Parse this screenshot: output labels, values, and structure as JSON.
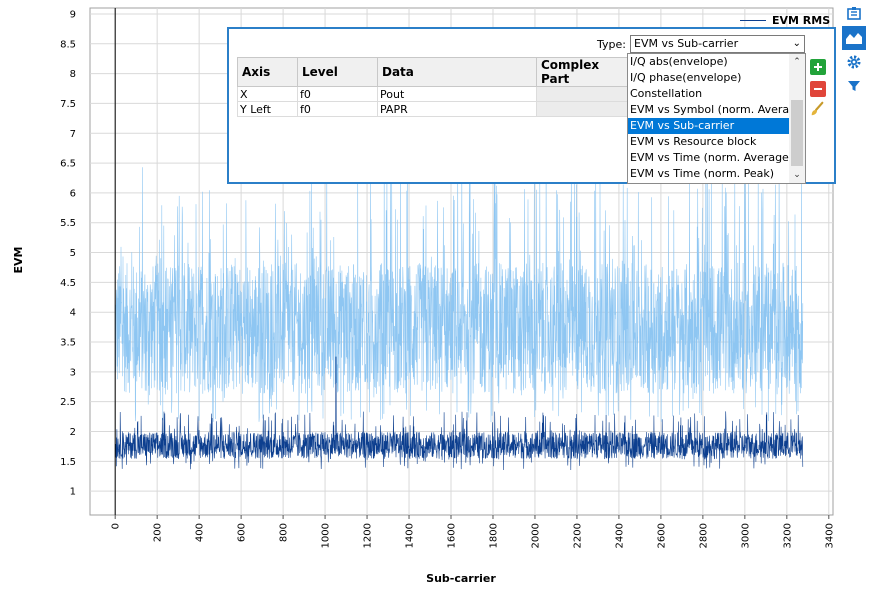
{
  "chart_data": {
    "type": "line",
    "title": "",
    "xlabel": "Sub-carrier",
    "ylabel": "EVM",
    "xlim": [
      -120,
      3420
    ],
    "ylim": [
      0.6,
      9.1
    ],
    "x_ticks": [
      0,
      200,
      400,
      600,
      800,
      1000,
      1200,
      1400,
      1600,
      1800,
      2000,
      2200,
      2400,
      2600,
      2800,
      3000,
      3200,
      3400
    ],
    "y_ticks": [
      1,
      1.5,
      2,
      2.5,
      3,
      3.5,
      4,
      4.5,
      5,
      5.5,
      6,
      6.5,
      7,
      7.5,
      8,
      8.5,
      9
    ],
    "grid": true,
    "legend_position": "top-right",
    "x_range": [
      0,
      3276
    ],
    "series": [
      {
        "name": "EVM RMS",
        "color": "#0d3f8f",
        "baseline": 1.7,
        "spread": 0.45,
        "min": 1.05,
        "max": 2.5,
        "spike_x": 1052,
        "spike_y": 3.25
      },
      {
        "name": "",
        "color": "#8ec6f2",
        "baseline": 3.4,
        "spread": 2.2,
        "min": 2.15,
        "max": 7.6
      }
    ]
  },
  "legend": {
    "label": "EVM RMS"
  },
  "config": {
    "type_label": "Type:",
    "type_value": "EVM vs Sub-carrier",
    "table_headers": [
      "Axis",
      "Level",
      "Data",
      "Complex Part"
    ],
    "rows": [
      {
        "axis": "X",
        "level": "f0",
        "data": "Pout"
      },
      {
        "axis": "Y Left",
        "level": "f0",
        "data": "PAPR"
      }
    ],
    "dropdown_items": [
      "I/Q abs(envelope)",
      "I/Q phase(envelope)",
      "Constellation",
      "EVM vs Symbol (norm. Average)",
      "EVM vs Sub-carrier",
      "EVM vs Resource block",
      "EVM vs Time (norm. Average)",
      "EVM vs Time (norm. Peak)"
    ],
    "selected_item": "EVM vs Sub-carrier"
  },
  "toolbar": {
    "icons": [
      "chart-settings-icon",
      "area-chart-icon",
      "gear-icon",
      "filter-icon"
    ],
    "active": "area-chart-icon",
    "accent": "#1a73c9"
  },
  "colors": {
    "accent": "#2b7fc8",
    "add": "#22a33a",
    "remove": "#e0453a"
  }
}
